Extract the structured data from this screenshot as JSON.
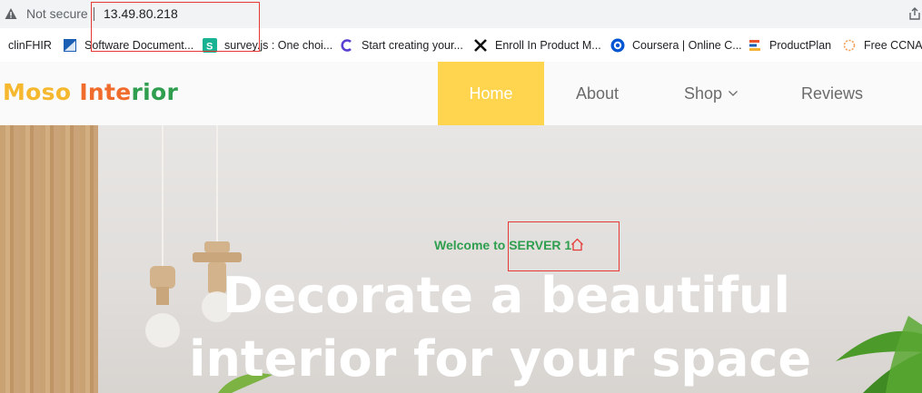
{
  "browser": {
    "not_secure": "Not secure",
    "url": "13.49.80.218"
  },
  "bookmarks": [
    {
      "label": "clinFHIR",
      "icon": "none",
      "color": ""
    },
    {
      "label": "Software Document...",
      "icon": "bookmark-blue-icon",
      "color": "#1a5fb4"
    },
    {
      "label": "survey.js : One choi...",
      "icon": "s-logo-icon",
      "color": "#19b394"
    },
    {
      "label": "Start creating your...",
      "icon": "c-logo-icon",
      "color": "#5b3fd1"
    },
    {
      "label": "Enroll In Product M...",
      "icon": "x-logo-icon",
      "color": "#111111"
    },
    {
      "label": "Coursera | Online C...",
      "icon": "coursera-icon",
      "color": "#0056d2"
    },
    {
      "label": "ProductPlan",
      "icon": "productplan-icon",
      "color": "#e8552e"
    },
    {
      "label": "Free CCNA S",
      "icon": "gear-orange-icon",
      "color": "#f2a35e"
    }
  ],
  "site": {
    "logo_part1": "Moso",
    "logo_part2": " Inte",
    "logo_part3": "rior",
    "nav": [
      "Home",
      "About",
      "Shop",
      "Reviews"
    ],
    "active_nav": "Home"
  },
  "hero": {
    "welcome": "Welcome to SERVER 1",
    "headline_line1": "Decorate a beautiful",
    "headline_line2": "interior for your space"
  },
  "colors": {
    "accent": "#ffd54f",
    "green": "#2f9e4f",
    "highlight_box": "#e53935"
  }
}
